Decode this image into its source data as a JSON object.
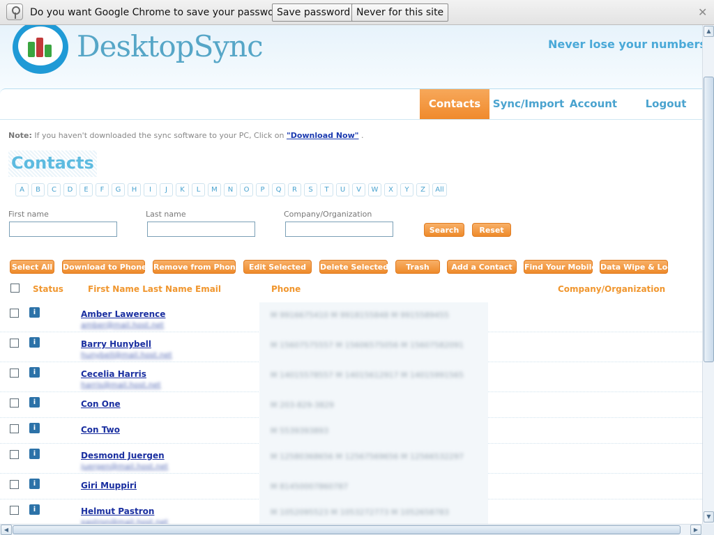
{
  "infobar": {
    "message": "Do you want Google Chrome to save your password?",
    "save_label": "Save password",
    "never_label": "Never for this site",
    "close_glyph": "✕"
  },
  "header": {
    "brand": "DesktopSync",
    "tagline": "Never lose your numbers again"
  },
  "nav": {
    "items": [
      "Contacts",
      "Sync/Import",
      "Account",
      "Logout"
    ],
    "active": "Contacts"
  },
  "note": {
    "prefix": "Note:",
    "text": " If you haven't downloaded the sync software to your PC, Click on ",
    "link": "\"Download Now\"",
    "suffix": " ."
  },
  "page_title": "Contacts",
  "alphabet": [
    "A",
    "B",
    "C",
    "D",
    "E",
    "F",
    "G",
    "H",
    "I",
    "J",
    "K",
    "L",
    "M",
    "N",
    "O",
    "P",
    "Q",
    "R",
    "S",
    "T",
    "U",
    "V",
    "W",
    "X",
    "Y",
    "Z",
    "All"
  ],
  "filters": {
    "first_name_label": "First name",
    "last_name_label": "Last name",
    "company_label": "Company/Organization",
    "first_name_value": "",
    "last_name_value": "",
    "company_value": "",
    "search_label": "Search",
    "reset_label": "Reset"
  },
  "actions": [
    "Select All",
    "Download to Phone",
    "Remove from Phone",
    "Edit Selected",
    "Delete Selected",
    "Trash",
    "Add a Contact",
    "Find Your Mobile",
    "Data Wipe & Lock"
  ],
  "table": {
    "headers": {
      "status": "Status",
      "name": "First Name Last Name Email",
      "phone": "Phone",
      "company": "Company/Organization"
    },
    "rows": [
      {
        "name": "Amber Lawerence",
        "email": "amber@mail.host.net",
        "phone": "M 9916675410   M 9918155848   M 9915589455"
      },
      {
        "name": "Barry Hunybell",
        "email": "hunybell@mail.host.net",
        "phone": "M 15607575557   M 15606575056   M 15607582091"
      },
      {
        "name": "Cecelia Harris",
        "email": "harris@mail.host.net",
        "phone": "M 14015578557   M 14015612917   M 14015991565"
      },
      {
        "name": "Con One",
        "email": "",
        "phone": "M 203-829-3829"
      },
      {
        "name": "Con Two",
        "email": "",
        "phone": "M 5539393893"
      },
      {
        "name": "Desmond Juergen",
        "email": "juergen@mail.host.net",
        "phone": "M 12580368656   M 12567569656   M 12566532297"
      },
      {
        "name": "Giri Muppiri",
        "email": "",
        "phone": "M 81450007860787"
      },
      {
        "name": "Helmut Pastron",
        "email": "pastron@mail.host.net",
        "phone": "M 1052095523   M 1053272773   M 1052658783"
      }
    ]
  }
}
